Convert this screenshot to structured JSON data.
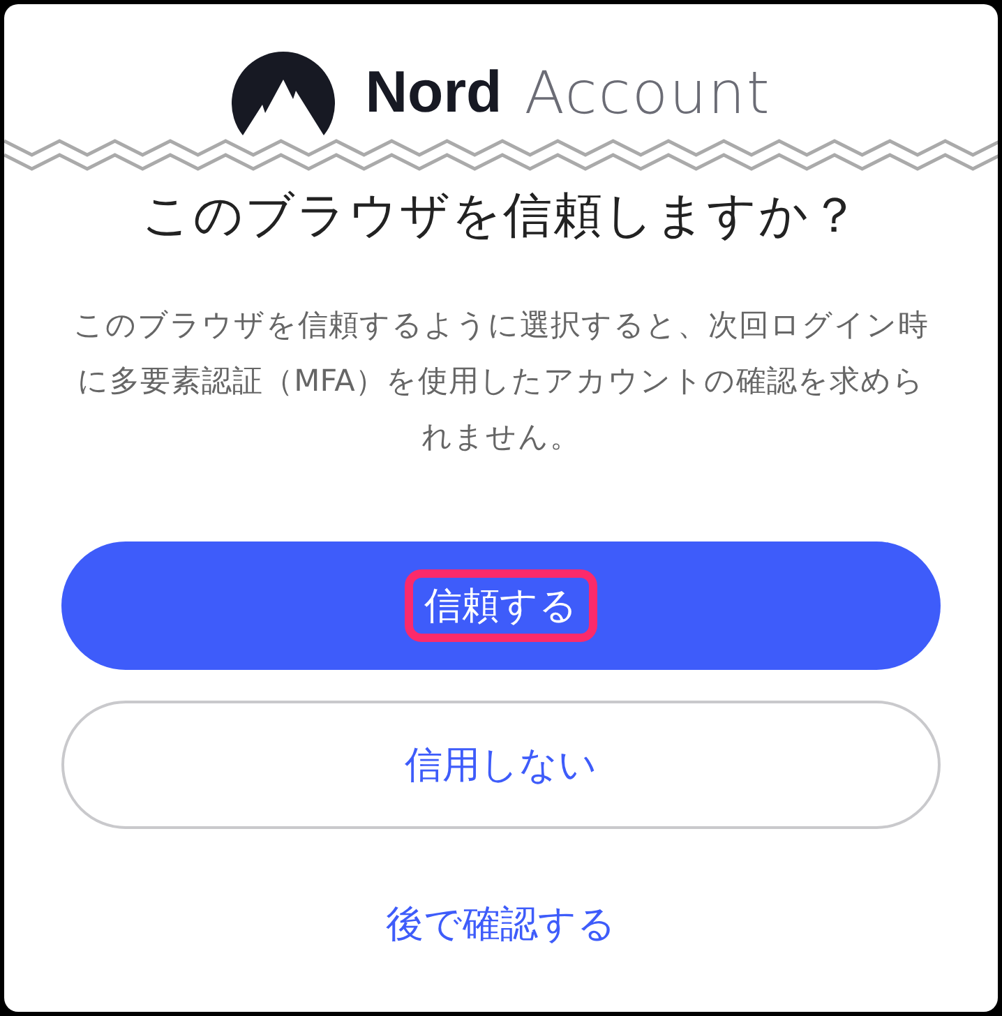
{
  "header": {
    "brand": "Nord",
    "product": "Account"
  },
  "title": "このブラウザを信頼しますか？",
  "description": "このブラウザを信頼するように選択すると、次回ログイン時に多要素認証（MFA）を使用したアカウントの確認を求められません。",
  "actions": [
    {
      "label": "信頼する",
      "kind": "primary",
      "highlighted": true
    },
    {
      "label": "信用しない",
      "kind": "secondary",
      "highlighted": false
    },
    {
      "label": "後で確認する",
      "kind": "link",
      "highlighted": false
    }
  ]
}
